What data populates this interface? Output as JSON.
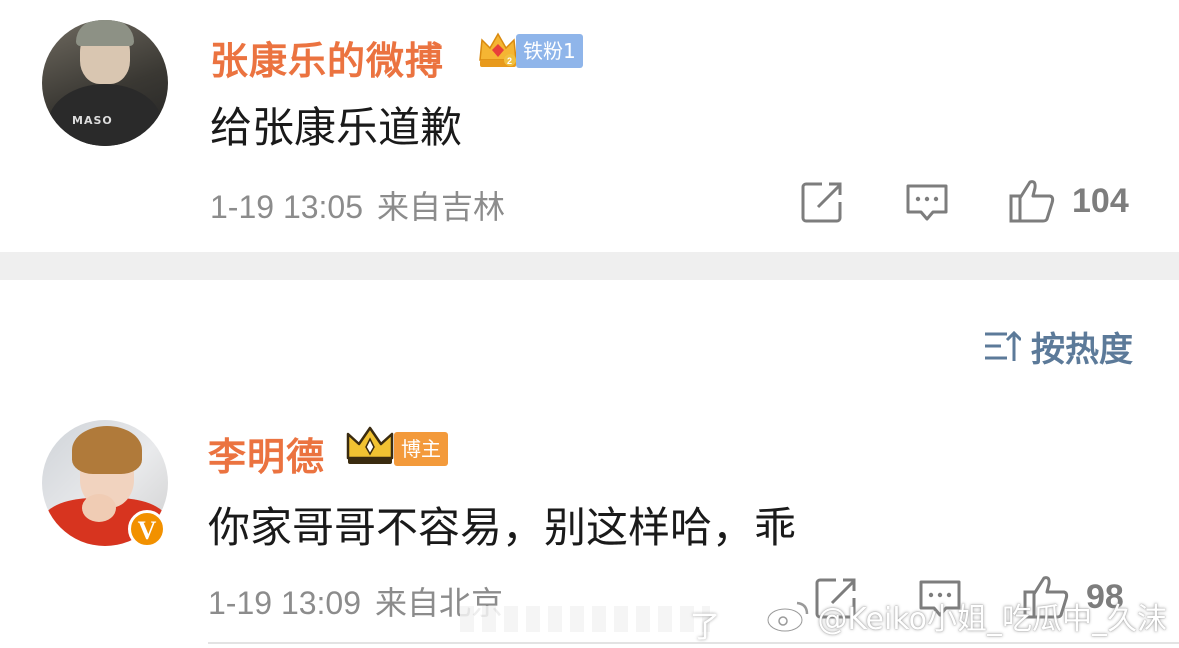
{
  "comments": [
    {
      "username": "张康乐的微搏",
      "badge_label": "铁粉1",
      "text": "给张康乐道歉",
      "timestamp": "1-19 13:05",
      "location": "来自吉林",
      "likes": "104"
    },
    {
      "username": "李明德",
      "badge_label": "博主",
      "text": "你家哥哥不容易，别这样哈，乖",
      "timestamp": "1-19 13:09",
      "location": "来自北京",
      "likes": "98",
      "verified_mark": "V"
    }
  ],
  "sort": {
    "label": "按热度"
  },
  "watermark": {
    "text": "@Keiko小姐_吃瓜中_久沫",
    "faded_text": "了"
  },
  "colors": {
    "username": "#eb7340",
    "fan_badge": "#8fb5ea",
    "blogger_badge": "#f39a3b",
    "sort_label": "#5c7a99",
    "meta_text": "#8c8c8c",
    "verified": "#f29100"
  },
  "icons": [
    "repost-icon",
    "comment-icon",
    "like-icon",
    "sort-icon",
    "crown-icon",
    "weibo-logo-icon"
  ]
}
